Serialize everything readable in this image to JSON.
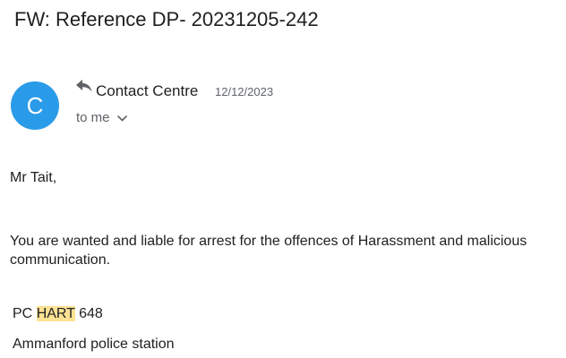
{
  "email": {
    "subject": "FW: Reference DP- 20231205-242",
    "sender": {
      "avatar_letter": "C",
      "avatar_color": "#2a9be8",
      "name": "Contact Centre",
      "date": "12/12/2023"
    },
    "recipient_label": "to me",
    "body": {
      "greeting": "Mr Tait,",
      "message": "You are wanted and liable for arrest for the offences of Harassment and malicious communication.",
      "signature": {
        "officer_prefix": "PC",
        "officer_name": "HART",
        "officer_number": "648",
        "station": "Ammanford police station"
      }
    },
    "highlight_color": "#fde293"
  }
}
